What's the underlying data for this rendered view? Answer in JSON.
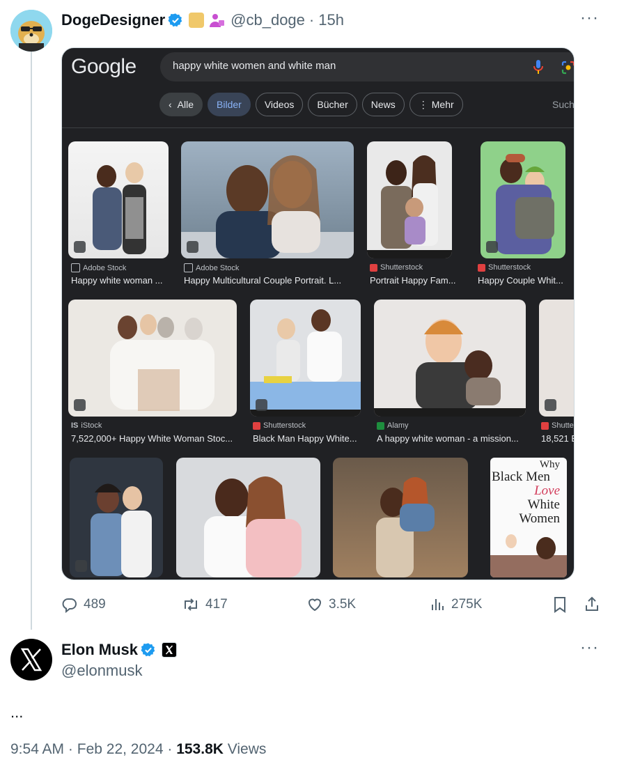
{
  "tweet1": {
    "author_name": "DogeDesigner",
    "handle": "@cb_doge",
    "separator": "·",
    "time": "15h",
    "more_label": "···",
    "actions": {
      "replies": "489",
      "retweets": "417",
      "likes": "3.5K",
      "views": "275K"
    }
  },
  "screenshot": {
    "logo": "Google",
    "query": "happy white women and white man",
    "chips": [
      "Alle",
      "Bilder",
      "Videos",
      "Bücher",
      "News",
      "Mehr"
    ],
    "active_chip": "Bilder",
    "cut_label": "Sucht",
    "results": [
      {
        "source": "Adobe Stock",
        "caption": "Happy white woman ..."
      },
      {
        "source": "Adobe Stock",
        "caption": "Happy Multicultural Couple Portrait. L..."
      },
      {
        "source": "Shutterstock",
        "caption": "Portrait Happy Fam..."
      },
      {
        "source": "Shutterstock",
        "caption": "Happy Couple Whit..."
      },
      {
        "source": "iStock",
        "caption": "7,522,000+ Happy White Woman Stoc..."
      },
      {
        "source": "Shutterstock",
        "caption": "Black Man Happy White..."
      },
      {
        "source": "Alamy",
        "caption": "A happy white woman - a mission..."
      },
      {
        "source": "Shutte",
        "caption": "18,521 E"
      }
    ],
    "book_cover_lines": [
      "Why",
      "Black Men",
      "Love",
      "White",
      "Women"
    ],
    "colors": {
      "bg": "#202124",
      "search_bg": "#303134",
      "active_chip": "#8ab4f8"
    }
  },
  "tweet2": {
    "author_name": "Elon Musk",
    "handle": "@elonmusk",
    "body": "...",
    "time": "9:54 AM",
    "date": "Feb 22, 2024",
    "separator": "·",
    "views_count": "153.8K",
    "views_label": "Views",
    "more_label": "···"
  },
  "colors": {
    "verified": "#1d9bf0",
    "text": "#0f1419",
    "muted": "#536471"
  }
}
